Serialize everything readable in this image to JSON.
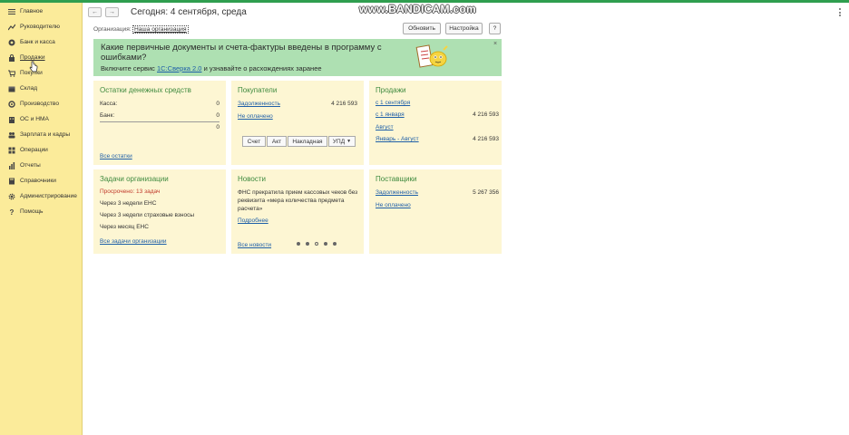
{
  "header": {
    "back": "←",
    "forward": "→",
    "title": "Сегодня: 4 сентября, среда",
    "watermark": "www.BANDICAM.com",
    "organization_label": "Организация:",
    "organization_value": "Наша организация",
    "refresh_button": "Обновить",
    "settings_button": "Настройка",
    "help_button": "?"
  },
  "sidebar": {
    "items": [
      {
        "label": "Главное",
        "icon": "menu-icon"
      },
      {
        "label": "Руководителю",
        "icon": "chart-icon"
      },
      {
        "label": "Банк и касса",
        "icon": "bank-icon"
      },
      {
        "label": "Продажи",
        "icon": "bag-icon"
      },
      {
        "label": "Покупки",
        "icon": "cart-icon"
      },
      {
        "label": "Склад",
        "icon": "box-icon"
      },
      {
        "label": "Производство",
        "icon": "factory-icon"
      },
      {
        "label": "ОС и НМА",
        "icon": "building-icon"
      },
      {
        "label": "Зарплата и кадры",
        "icon": "people-icon"
      },
      {
        "label": "Операции",
        "icon": "operations-icon"
      },
      {
        "label": "Отчеты",
        "icon": "report-icon"
      },
      {
        "label": "Справочники",
        "icon": "book-icon"
      },
      {
        "label": "Администрирование",
        "icon": "gear-icon"
      },
      {
        "label": "Помощь",
        "icon": "help-icon"
      }
    ]
  },
  "banner": {
    "title": "Какие первичные документы и счета-фактуры введены в программу с ошибками?",
    "text_before": "Включите сервис ",
    "link": "1С:Сверка 2.0",
    "text_after": " и узнавайте о расхождениях заранее",
    "close": "×"
  },
  "cash": {
    "title": "Остатки денежных средств",
    "kassa_label": "Касса:",
    "kassa_value": "0",
    "bank_label": "Банк:",
    "bank_value": "0",
    "total": "0",
    "all_link": "Все остатки"
  },
  "buyers": {
    "title": "Покупатели",
    "debt_link": "Задолженность",
    "debt_value": "4 216 593",
    "unpaid_link": "Не оплачено",
    "buttons": [
      "Счет",
      "Акт",
      "Накладная",
      "УПД"
    ]
  },
  "sales": {
    "title": "Продажи",
    "rows": [
      {
        "label": "с 1 сентября",
        "value": ""
      },
      {
        "label": "с 1 января",
        "value": "4 216 593"
      },
      {
        "label": "Август",
        "value": ""
      },
      {
        "label": "Январь - Август",
        "value": "4 216 593"
      }
    ]
  },
  "tasks": {
    "title": "Задачи организации",
    "overdue": "Просрочено: 13 задач",
    "items": [
      "Через 3 недели ЕНС",
      "Через 3 недели страховые взносы",
      "Через месяц ЕНС"
    ],
    "all_link": "Все задачи организации"
  },
  "news": {
    "title": "Новости",
    "text": "ФНС прекратила прием кассовых чеков без реквизита «мера количества предмета расчета»",
    "more_link": "Подробнее",
    "all_link": "Все новости"
  },
  "suppliers": {
    "title": "Поставщики",
    "debt_link": "Задолженность",
    "debt_value": "5 267 356",
    "unpaid_link": "Не оплачено"
  },
  "colors": {
    "sidebar": "#fbeb9a",
    "banner": "#aee0b2",
    "panel": "#fdf6d3",
    "panel_title": "#3f8a3f",
    "link": "#1e5fa8",
    "overdue": "#c0392b"
  }
}
